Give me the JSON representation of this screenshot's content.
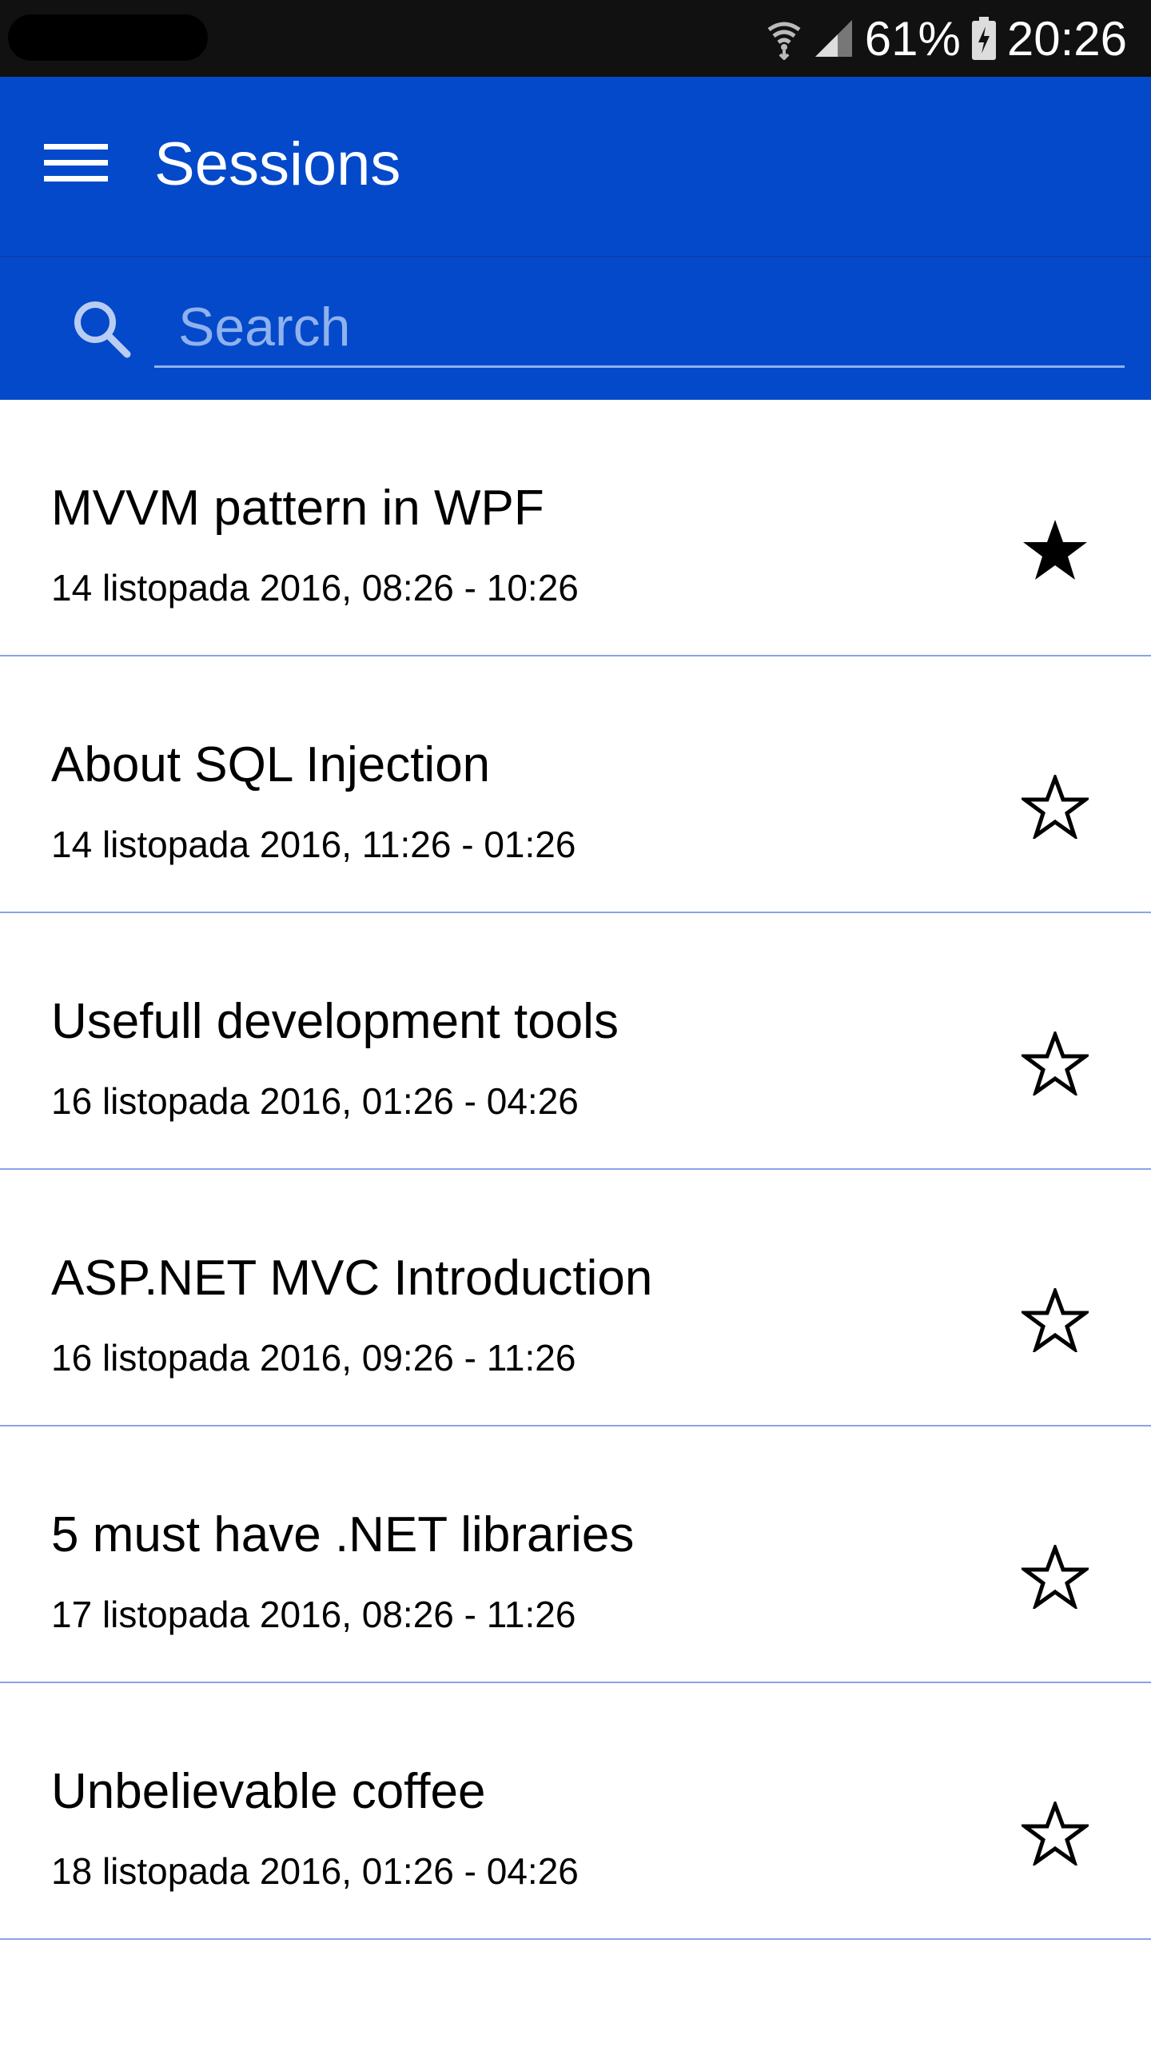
{
  "status_bar": {
    "battery_percent": "61%",
    "time": "20:26",
    "icons": [
      "wifi-icon",
      "signal-icon",
      "battery-charging-icon"
    ]
  },
  "app_bar": {
    "title": "Sessions",
    "menu_icon": "hamburger-menu-icon"
  },
  "search": {
    "placeholder": "Search",
    "value": "",
    "icon": "search-icon"
  },
  "colors": {
    "primary": "#0449CA",
    "divider": "#8aa3e8",
    "search_underline": "#8fb2ee"
  },
  "sessions": [
    {
      "title": "MVVM pattern in WPF",
      "time": "14 listopada 2016, 08:26 - 10:26",
      "favorite": true
    },
    {
      "title": "About SQL Injection",
      "time": "14 listopada 2016, 11:26 - 01:26",
      "favorite": false
    },
    {
      "title": "Usefull development tools",
      "time": "16 listopada 2016, 01:26 - 04:26",
      "favorite": false
    },
    {
      "title": "ASP.NET MVC Introduction",
      "time": "16 listopada 2016, 09:26 - 11:26",
      "favorite": false
    },
    {
      "title": "5 must have .NET libraries",
      "time": "17 listopada 2016, 08:26 - 11:26",
      "favorite": false
    },
    {
      "title": "Unbelievable coffee",
      "time": "18 listopada 2016, 01:26 - 04:26",
      "favorite": false
    }
  ]
}
